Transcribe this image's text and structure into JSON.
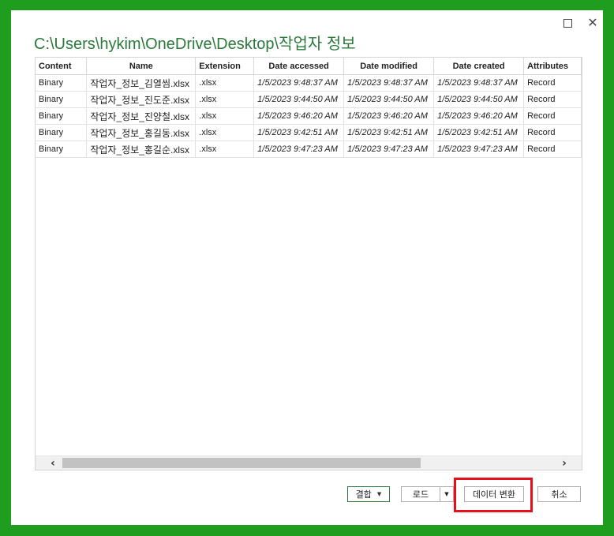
{
  "window": {
    "path_title": "C:\\Users\\hykim\\OneDrive\\Desktop\\작업자 정보"
  },
  "table": {
    "columns": [
      "Content",
      "Name",
      "Extension",
      "Date accessed",
      "Date modified",
      "Date created",
      "Attributes"
    ],
    "rows": [
      [
        "Binary",
        "작업자_정보_김열씸.xlsx",
        ".xlsx",
        "1/5/2023 9:48:37 AM",
        "1/5/2023 9:48:37 AM",
        "1/5/2023 9:48:37 AM",
        "Record"
      ],
      [
        "Binary",
        "작업자_정보_진도준.xlsx",
        ".xlsx",
        "1/5/2023 9:44:50 AM",
        "1/5/2023 9:44:50 AM",
        "1/5/2023 9:44:50 AM",
        "Record"
      ],
      [
        "Binary",
        "작업자_정보_진양철.xlsx",
        ".xlsx",
        "1/5/2023 9:46:20 AM",
        "1/5/2023 9:46:20 AM",
        "1/5/2023 9:46:20 AM",
        "Record"
      ],
      [
        "Binary",
        "작업자_정보_홍길동.xlsx",
        ".xlsx",
        "1/5/2023 9:42:51 AM",
        "1/5/2023 9:42:51 AM",
        "1/5/2023 9:42:51 AM",
        "Record"
      ],
      [
        "Binary",
        "작업자_정보_홍길순.xlsx",
        ".xlsx",
        "1/5/2023 9:47:23 AM",
        "1/5/2023 9:47:23 AM",
        "1/5/2023 9:47:23 AM",
        "Record"
      ]
    ]
  },
  "buttons": {
    "combine": "결합",
    "load": "로드",
    "transform": "데이터 변환",
    "cancel": "취소"
  },
  "icons": {
    "maximize": "maximize-icon",
    "close": "close-icon",
    "scroll_left": "chevron-left-icon",
    "scroll_right": "chevron-right-icon",
    "dropdown": "caret-down-icon"
  },
  "colors": {
    "title_green": "#2b7a3b",
    "background_green": "#1f9d1f",
    "highlight_red": "#e5101b"
  }
}
